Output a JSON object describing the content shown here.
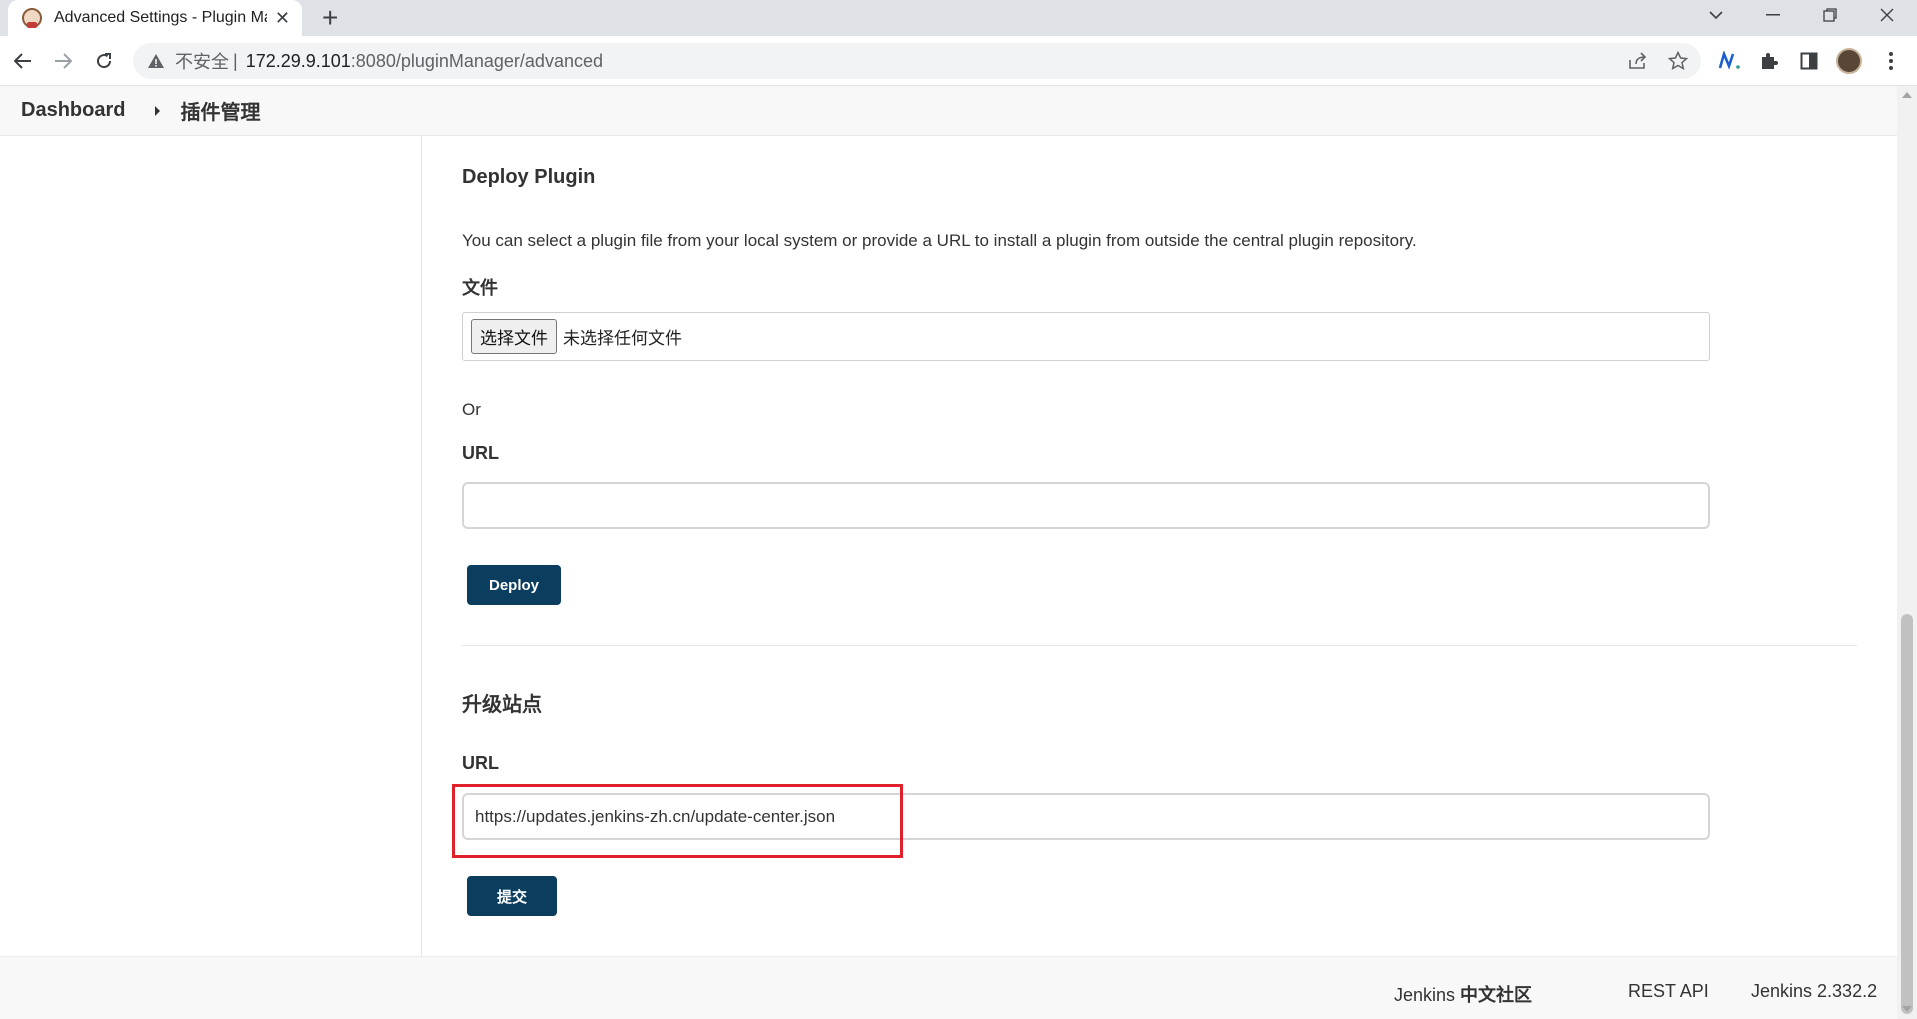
{
  "browser": {
    "tab_title": "Advanced Settings - Plugin Ma",
    "new_tab": "+",
    "insecure_label": "不安全",
    "separator": "|",
    "url_host": "172.29.9.101",
    "url_path": ":8080/pluginManager/advanced"
  },
  "breadcrumb": {
    "items": [
      "Dashboard",
      "插件管理"
    ]
  },
  "deploy": {
    "title": "Deploy Plugin",
    "description": "You can select a plugin file from your local system or provide a URL to install a plugin from outside the central plugin repository.",
    "file_label": "文件",
    "file_button": "选择文件",
    "file_none": "未选择任何文件",
    "or_text": "Or",
    "url_label": "URL",
    "url_value": "",
    "button": "Deploy"
  },
  "update_site": {
    "title": "升级站点",
    "url_label": "URL",
    "url_value": "https://updates.jenkins-zh.cn/update-center.json",
    "button": "提交"
  },
  "footer": {
    "community_prefix": "Jenkins ",
    "community_bold": "中文社区",
    "rest_api": "REST API",
    "version": "Jenkins 2.332.2"
  },
  "colors": {
    "primary_button": "#0b3d5e",
    "highlight_box": "#e0202a"
  }
}
